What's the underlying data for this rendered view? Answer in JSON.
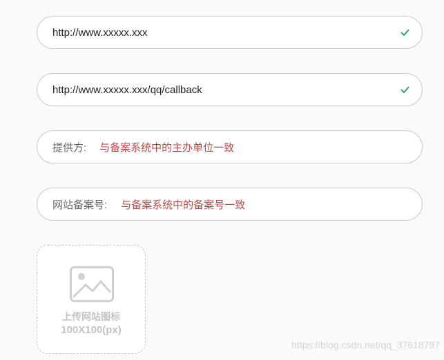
{
  "form": {
    "website_url": {
      "value": "http://www.xxxxx.xxx",
      "check_icon": "check-icon",
      "check_color": "#27a67a"
    },
    "callback_url": {
      "value": "http://www.xxxxx.xxx/qq/callback",
      "check_icon": "check-icon",
      "check_color": "#27a67a"
    },
    "provider": {
      "label": "提供方:",
      "value": "与备案系统中的主办单位一致"
    },
    "icp_number": {
      "label": "网站备案号:",
      "value": "与备案系统中的备案号一致"
    },
    "upload": {
      "icon": "image-icon",
      "label_line1": "上传网站图标",
      "label_line2": "100X100(px)"
    }
  },
  "watermark": "https://blog.csdn.net/qq_37618797",
  "colors": {
    "accent_red": "#b84a4a",
    "success_green": "#27a67a",
    "border": "#c8c8c8"
  }
}
